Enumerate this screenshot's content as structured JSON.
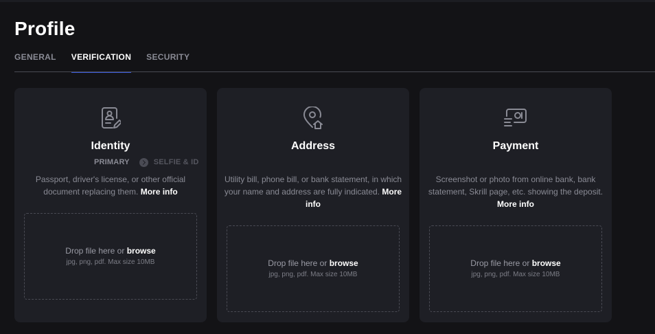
{
  "page": {
    "title": "Profile"
  },
  "tabs": [
    {
      "label": "GENERAL"
    },
    {
      "label": "VERIFICATION"
    },
    {
      "label": "SECURITY"
    }
  ],
  "active_tab": "VERIFICATION",
  "colors": {
    "background": "#131316",
    "card": "#1e1f25",
    "accent": "#3b5bdb",
    "muted": "#8a8b95"
  },
  "cards": [
    {
      "icon": "id-document-icon",
      "title": "Identity",
      "steps": {
        "primary": "PRIMARY",
        "secondary": "SELFIE & ID"
      },
      "description": "Passport, driver's license, or other official document replacing them.",
      "more_info": "More info",
      "dropzone": {
        "text": "Drop file here or",
        "browse": "browse",
        "hint": "jpg, png, pdf. Max size 10MB"
      }
    },
    {
      "icon": "location-home-icon",
      "title": "Address",
      "description": "Utility bill, phone bill, or bank statement, in which your name and address are fully indicated.",
      "more_info": "More info",
      "dropzone": {
        "text": "Drop file here or",
        "browse": "browse",
        "hint": "jpg, png, pdf. Max size 10MB"
      }
    },
    {
      "icon": "payment-card-icon",
      "title": "Payment",
      "description": "Screenshot or photo from online bank, bank statement, Skrill page, etc. showing the deposit.",
      "more_info": "More info",
      "dropzone": {
        "text": "Drop file here or",
        "browse": "browse",
        "hint": "jpg, png, pdf. Max size 10MB"
      }
    }
  ]
}
